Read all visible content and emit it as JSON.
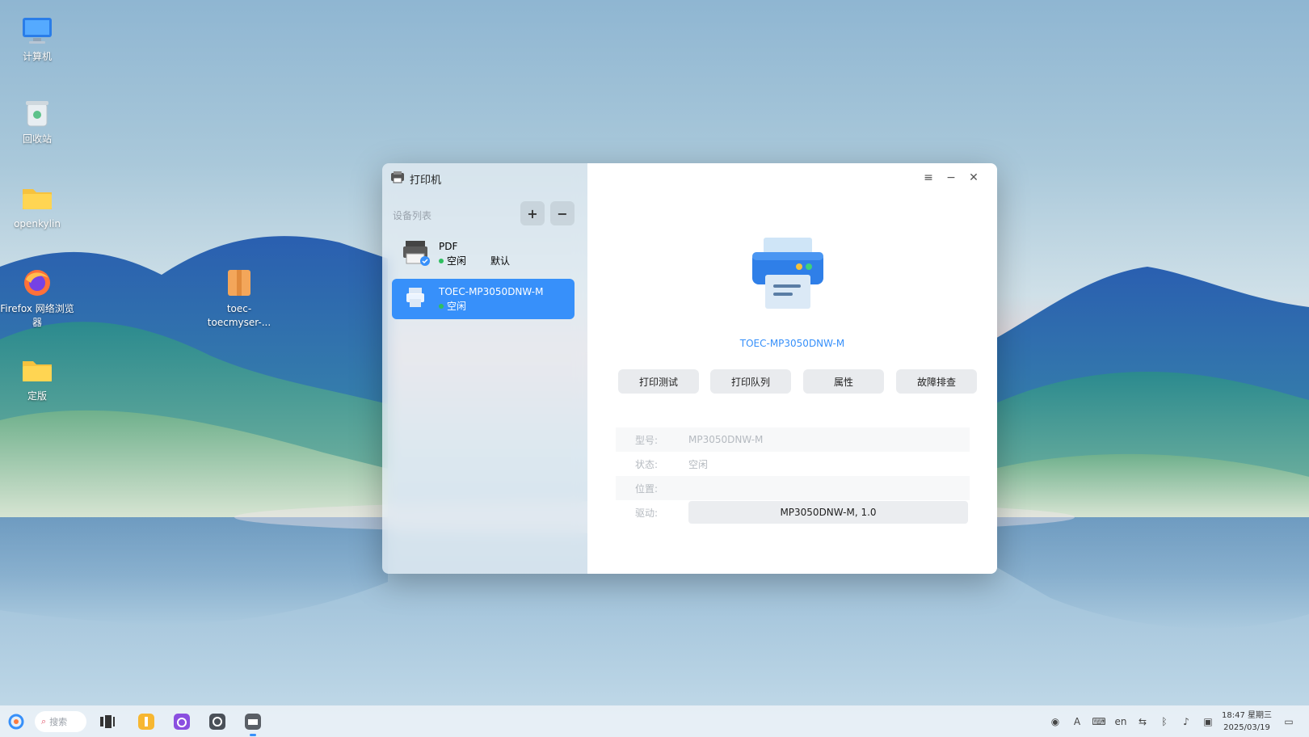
{
  "desktop": {
    "icons": [
      {
        "label": "计算机"
      },
      {
        "label": "回收站"
      },
      {
        "label": "openkylin"
      },
      {
        "label": "Firefox 网络浏览器"
      },
      {
        "label": "toec-toecmyser-..."
      },
      {
        "label": "定版"
      }
    ]
  },
  "window": {
    "title": "打印机",
    "device_list_label": "设备列表",
    "add_label": "+",
    "remove_label": "−",
    "devices": [
      {
        "name": "PDF",
        "status": "空闲",
        "default": "默认"
      },
      {
        "name": "TOEC-MP3050DNW-M",
        "status": "空闲"
      }
    ],
    "controls": {
      "menu": "≡",
      "minimize": "−",
      "close": "✕"
    },
    "selected_printer": "TOEC-MP3050DNW-M",
    "actions": [
      "打印测试",
      "打印队列",
      "属性",
      "故障排查"
    ],
    "info": [
      {
        "key": "型号:",
        "value": "MP3050DNW-M"
      },
      {
        "key": "状态:",
        "value": "空闲"
      },
      {
        "key": "位置:",
        "value": ""
      },
      {
        "key": "驱动:",
        "value": "MP3050DNW-M, 1.0"
      }
    ]
  },
  "taskbar": {
    "search_placeholder": "搜索",
    "clock_time": "18:47 星期三",
    "clock_date": "2025/03/19"
  },
  "colors": {
    "accent": "#3790fa",
    "status_idle": "#2fbf60"
  }
}
